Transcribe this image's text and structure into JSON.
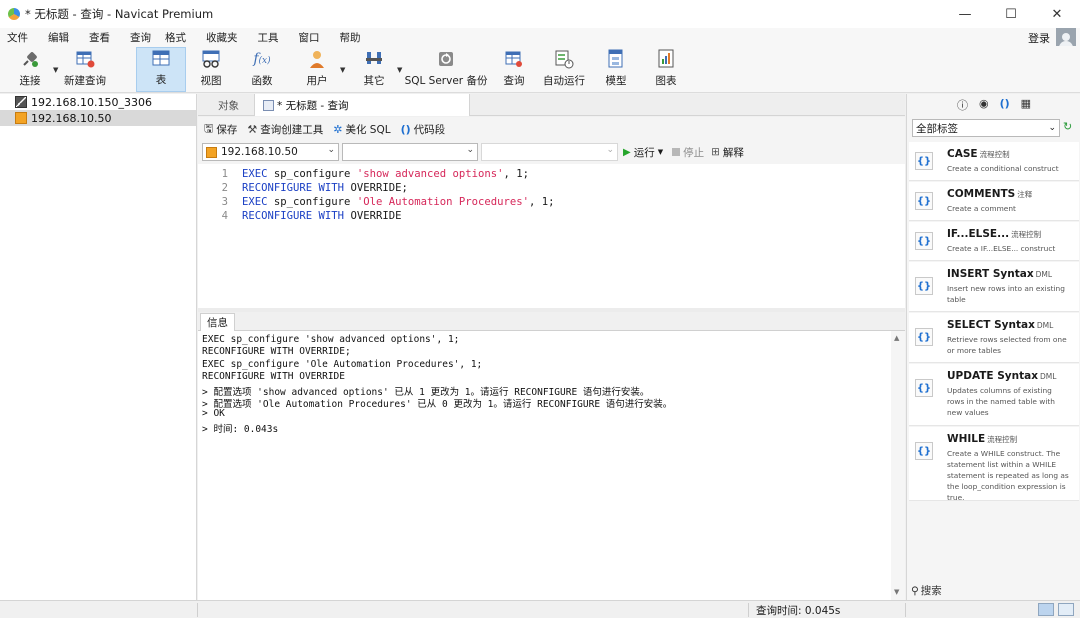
{
  "window": {
    "title": "* 无标题 - 查询 - Navicat Premium",
    "controls": [
      "minimize-icon",
      "maximize-icon",
      "close-icon"
    ]
  },
  "menu": {
    "items": [
      "文件",
      "编辑",
      "查看",
      "查询",
      "格式",
      "收藏夹",
      "工具",
      "窗口",
      "帮助"
    ],
    "login_label": "登录"
  },
  "toolbar": {
    "buttons": [
      {
        "label": "连接",
        "icon": "plug-icon"
      },
      {
        "label": "新建查询",
        "icon": "new-query-icon"
      },
      {
        "label": "表",
        "icon": "table-icon"
      },
      {
        "label": "视图",
        "icon": "view-icon"
      },
      {
        "label": "函数",
        "icon": "function-icon"
      },
      {
        "label": "用户",
        "icon": "user-icon"
      },
      {
        "label": "其它",
        "icon": "tools-icon"
      },
      {
        "label": "SQL Server 备份",
        "icon": "backup-icon"
      },
      {
        "label": "查询",
        "icon": "query-icon"
      },
      {
        "label": "自动运行",
        "icon": "automation-icon"
      },
      {
        "label": "模型",
        "icon": "model-icon"
      },
      {
        "label": "图表",
        "icon": "chart-icon"
      }
    ],
    "active": "表"
  },
  "navigator": {
    "connections": [
      {
        "name": "192.168.10.150_3306",
        "type": "mysql",
        "selected": false
      },
      {
        "name": "192.168.10.50",
        "type": "sqlserver",
        "selected": true
      }
    ]
  },
  "tabs": {
    "objects_label": "对象",
    "query_tab_label": "* 无标题 - 查询"
  },
  "query_toolbar": {
    "save": "保存",
    "builder": "查询创建工具",
    "beautify": "美化 SQL",
    "snippet": "代码段",
    "connection": "192.168.10.50",
    "database": "",
    "schema": "",
    "run": "运行",
    "stop": "停止",
    "explain": "解释"
  },
  "editor": {
    "lines": [
      {
        "num": "1",
        "kw1": "EXEC",
        "plain1": " sp_configure ",
        "str": "'show advanced options'",
        "plain2": ", 1;"
      },
      {
        "num": "2",
        "kw1": "RECONFIGURE WITH",
        "plain1": " OVERRIDE;",
        "str": "",
        "plain2": ""
      },
      {
        "num": "3",
        "kw1": "EXEC",
        "plain1": " sp_configure ",
        "str": "'Ole Automation Procedures'",
        "plain2": ", 1;"
      },
      {
        "num": "4",
        "kw1": "RECONFIGURE WITH",
        "plain1": " OVERRIDE",
        "str": "",
        "plain2": ""
      }
    ]
  },
  "info": {
    "tab_label": "信息",
    "lines": [
      "EXEC sp_configure 'show advanced options', 1;",
      "RECONFIGURE WITH OVERRIDE;",
      "EXEC sp_configure 'Ole Automation Procedures', 1;",
      "RECONFIGURE WITH OVERRIDE",
      "> 配置选项 'show advanced options' 已从 1 更改为 1。请运行 RECONFIGURE 语句进行安装。",
      "> 配置选项 'Ole Automation Procedures' 已从 0 更改为 1。请运行 RECONFIGURE 语句进行安装。",
      "> OK",
      "> 时间: 0.043s"
    ]
  },
  "snippets": {
    "filter": "全部标签",
    "search_label": "搜索",
    "items": [
      {
        "title": "CASE",
        "tag": "流程控制",
        "desc": "Create a conditional construct"
      },
      {
        "title": "COMMENTS",
        "tag": "注释",
        "desc": "Create a comment"
      },
      {
        "title": "IF...ELSE...",
        "tag": "流程控制",
        "desc": "Create a IF...ELSE... construct"
      },
      {
        "title": "INSERT Syntax",
        "tag": "DML",
        "desc": "Insert new rows into an existing table"
      },
      {
        "title": "SELECT Syntax",
        "tag": "DML",
        "desc": "Retrieve rows selected from one or more tables"
      },
      {
        "title": "UPDATE Syntax",
        "tag": "DML",
        "desc": "Updates columns of existing rows in the named table with new values"
      },
      {
        "title": "WHILE",
        "tag": "流程控制",
        "desc": "Create a WHILE construct. The statement list within a WHILE statement is repeated as long as the loop_condition expression is true."
      }
    ]
  },
  "status": {
    "query_time": "查询时间: 0.045s"
  },
  "colors": {
    "keyword": "#1a3fc4",
    "string": "#d6285a",
    "accent": "#1e6fd0",
    "active_toolbar": "#cde4f7"
  }
}
